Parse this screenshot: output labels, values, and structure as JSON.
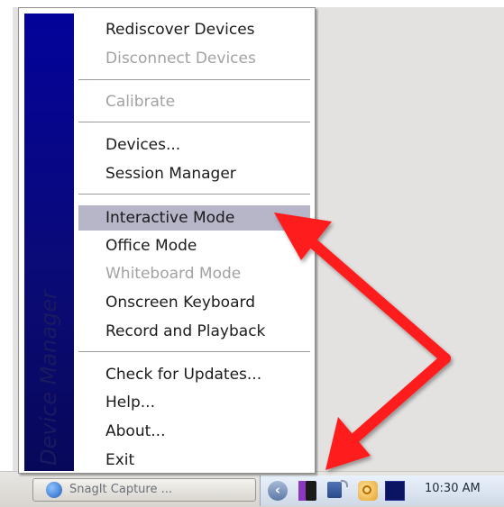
{
  "menu": {
    "side_label": "Device Manager",
    "items": [
      {
        "label": "Rediscover Devices",
        "enabled": true
      },
      {
        "label": "Disconnect Devices",
        "enabled": false
      },
      {
        "label": "Calibrate",
        "enabled": false
      },
      {
        "label": "Devices...",
        "enabled": true
      },
      {
        "label": "Session Manager",
        "enabled": true
      },
      {
        "label": "Interactive Mode",
        "enabled": true,
        "highlighted": true
      },
      {
        "label": "Office Mode",
        "enabled": true
      },
      {
        "label": "Whiteboard Mode",
        "enabled": false
      },
      {
        "label": "Onscreen Keyboard",
        "enabled": true
      },
      {
        "label": "Record and Playback",
        "enabled": true
      },
      {
        "label": "Check for Updates...",
        "enabled": true
      },
      {
        "label": "Help...",
        "enabled": true
      },
      {
        "label": "About...",
        "enabled": true
      },
      {
        "label": "Exit",
        "enabled": true
      }
    ]
  },
  "taskbar": {
    "task_label": "SnagIt Capture ...",
    "clock": "10:30 AM",
    "tray_icons": [
      "show-hidden-icons-icon",
      "pen-device-icon",
      "network-icon",
      "update-icon",
      "monitor-icon"
    ]
  },
  "colors": {
    "menu_side": "#03039b",
    "highlight": "#b7b5c8",
    "arrow": "#ff1a1a"
  }
}
